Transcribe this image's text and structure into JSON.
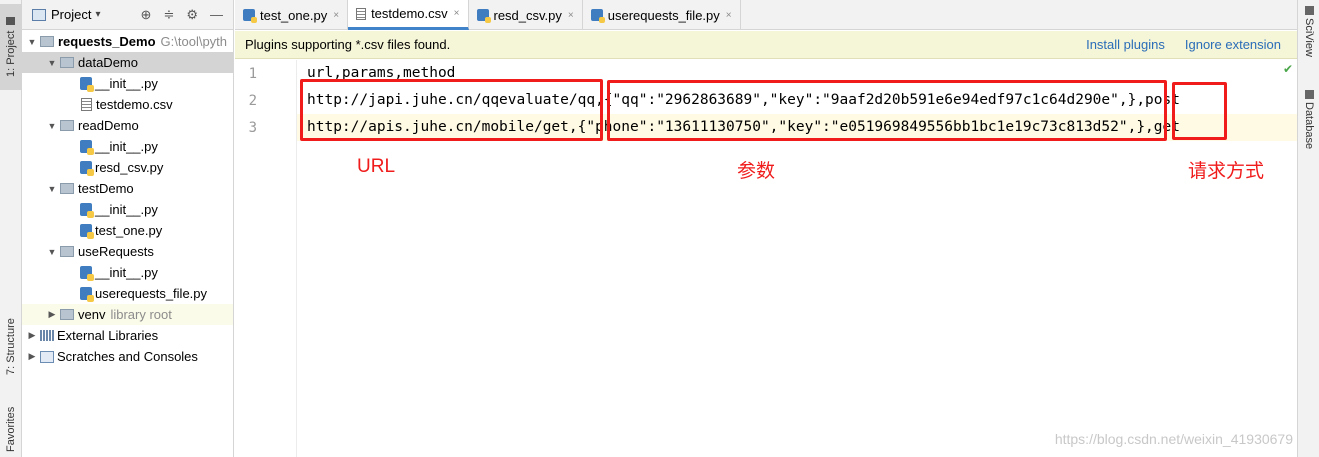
{
  "left_strip": {
    "project_tab": "1: Project",
    "structure_tab": "7: Structure",
    "favorites_tab": "Favorites"
  },
  "project_panel": {
    "title": "Project",
    "tree": [
      {
        "label": "requests_Demo",
        "extra": "G:\\tool\\pyth",
        "type": "root",
        "arrow": "▼"
      },
      {
        "label": "dataDemo",
        "type": "folder",
        "arrow": "▼"
      },
      {
        "label": "__init__.py",
        "type": "py"
      },
      {
        "label": "testdemo.csv",
        "type": "csv"
      },
      {
        "label": "readDemo",
        "type": "folder",
        "arrow": "▼"
      },
      {
        "label": "__init__.py",
        "type": "py"
      },
      {
        "label": "resd_csv.py",
        "type": "py"
      },
      {
        "label": "testDemo",
        "type": "folder",
        "arrow": "▼"
      },
      {
        "label": "__init__.py",
        "type": "py"
      },
      {
        "label": "test_one.py",
        "type": "py"
      },
      {
        "label": "useRequests",
        "type": "folder",
        "arrow": "▼"
      },
      {
        "label": "__init__.py",
        "type": "py"
      },
      {
        "label": "userequests_file.py",
        "type": "py"
      },
      {
        "label": "venv",
        "extra": "library root",
        "type": "folder",
        "arrow": "▶"
      },
      {
        "label": "External Libraries",
        "type": "lib",
        "arrow": "▶"
      },
      {
        "label": "Scratches and Consoles",
        "type": "scratch",
        "arrow": "▶"
      }
    ]
  },
  "tabs": [
    {
      "label": "test_one.py",
      "kind": "py"
    },
    {
      "label": "testdemo.csv",
      "kind": "csv",
      "active": true
    },
    {
      "label": "resd_csv.py",
      "kind": "py"
    },
    {
      "label": "userequests_file.py",
      "kind": "py"
    }
  ],
  "close_glyph": "×",
  "notification": {
    "text": "Plugins supporting *.csv files found.",
    "install": "Install plugins",
    "ignore": "Ignore extension"
  },
  "editor": {
    "line_numbers": [
      "1",
      "2",
      "3"
    ],
    "lines": [
      "url,params,method",
      "http://japi.juhe.cn/qqevaluate/qq,{\"qq\":\"2962863689\",\"key\":\"9aaf2d20b591e6e94edf97c1c64d290e\",},post",
      "http://apis.juhe.cn/mobile/get,{\"phone\":\"13611130750\",\"key\":\"e051969849556bb1bc1e19c73c813d52\",},get"
    ]
  },
  "annotations": {
    "url": "URL",
    "params": "参数",
    "method": "请求方式"
  },
  "right_strip": {
    "sciview": "SciView",
    "database": "Database"
  },
  "watermark": "https://blog.csdn.net/weixin_41930679"
}
